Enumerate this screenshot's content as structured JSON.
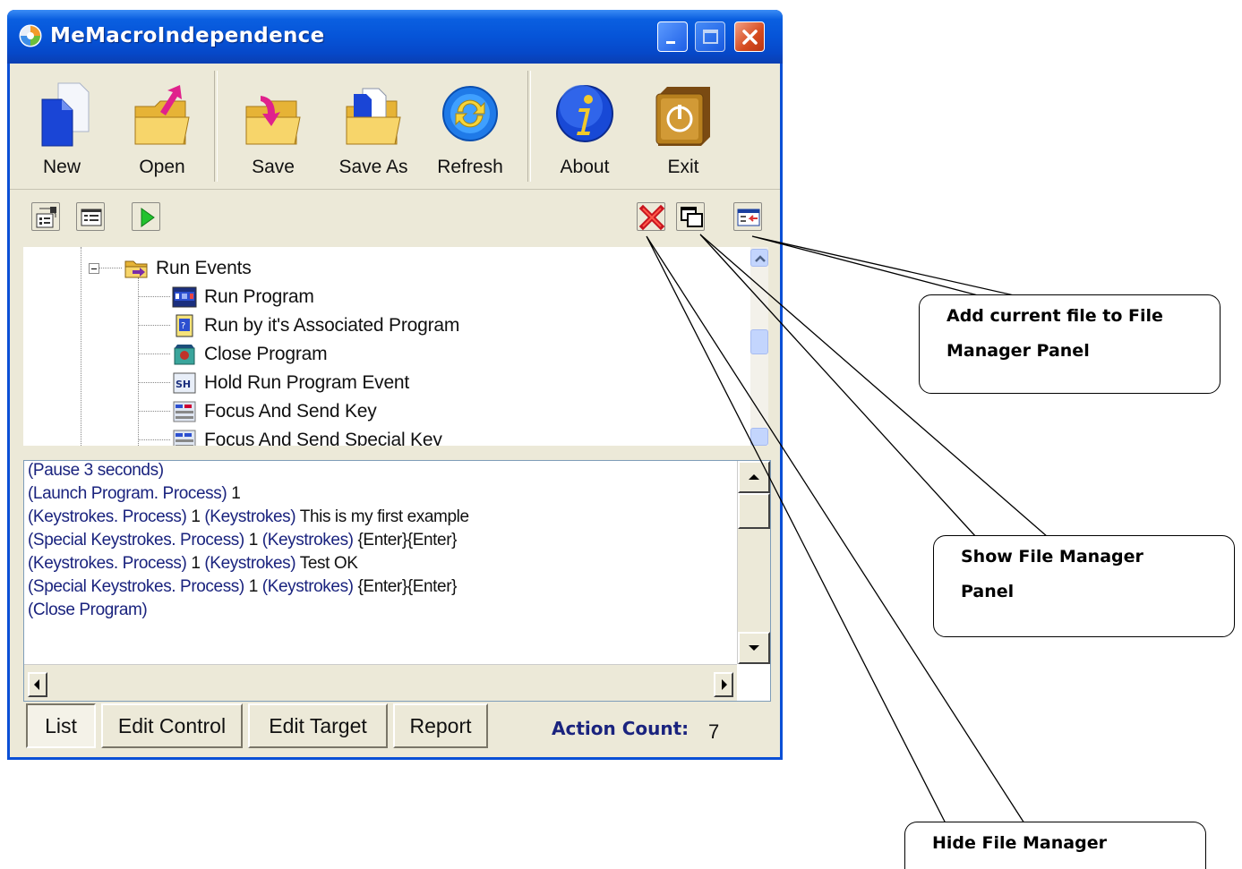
{
  "window": {
    "title": "MeMacroIndependence"
  },
  "toolbar": {
    "buttons": [
      {
        "label": "New",
        "icon": "new-document-icon"
      },
      {
        "label": "Open",
        "icon": "open-folder-icon"
      },
      {
        "label": "Save",
        "icon": "save-folder-icon"
      },
      {
        "label": "Save As",
        "icon": "save-as-folder-icon"
      },
      {
        "label": "Refresh",
        "icon": "refresh-icon"
      },
      {
        "label": "About",
        "icon": "info-icon"
      },
      {
        "label": "Exit",
        "icon": "power-icon"
      }
    ]
  },
  "small_toolbar": {
    "left": [
      "properties-icon",
      "list-view-icon",
      "play-icon"
    ],
    "right": [
      "hide-file-manager-icon",
      "show-file-manager-icon",
      "add-file-to-manager-icon"
    ]
  },
  "tree": {
    "parent": "Run Events",
    "children": [
      "Run Program",
      "Run by it's Associated Program",
      "Close Program",
      "Hold Run Program Event",
      "Focus And Send Key",
      "Focus And Send Special Key"
    ]
  },
  "log": {
    "lines": [
      [
        "(Pause 3 seconds)",
        ""
      ],
      [
        "(Launch Program. Process)",
        " 1"
      ],
      [
        "(Keystrokes.  Process)",
        " 1 ",
        "(Keystrokes)",
        " This is my first example"
      ],
      [
        "(Special Keystrokes. Process)",
        " 1 ",
        "(Keystrokes)",
        " {Enter}{Enter}"
      ],
      [
        "(Keystrokes.  Process)",
        " 1 ",
        "(Keystrokes)",
        " Test OK"
      ],
      [
        "(Special Keystrokes. Process)",
        " 1 ",
        "(Keystrokes)",
        " {Enter}{Enter}"
      ],
      [
        "(Close Program)",
        ""
      ]
    ]
  },
  "tabs": [
    "List",
    "Edit Control",
    "Edit Target",
    "Report"
  ],
  "status": {
    "action_count_label": "Action Count:",
    "action_count_value": "7"
  },
  "callouts": {
    "add_file_line1": "Add current file to File",
    "add_file_line2": "Manager Panel",
    "show_line1": "Show File Manager",
    "show_line2": "Panel",
    "hide": "Hide File Manager"
  }
}
